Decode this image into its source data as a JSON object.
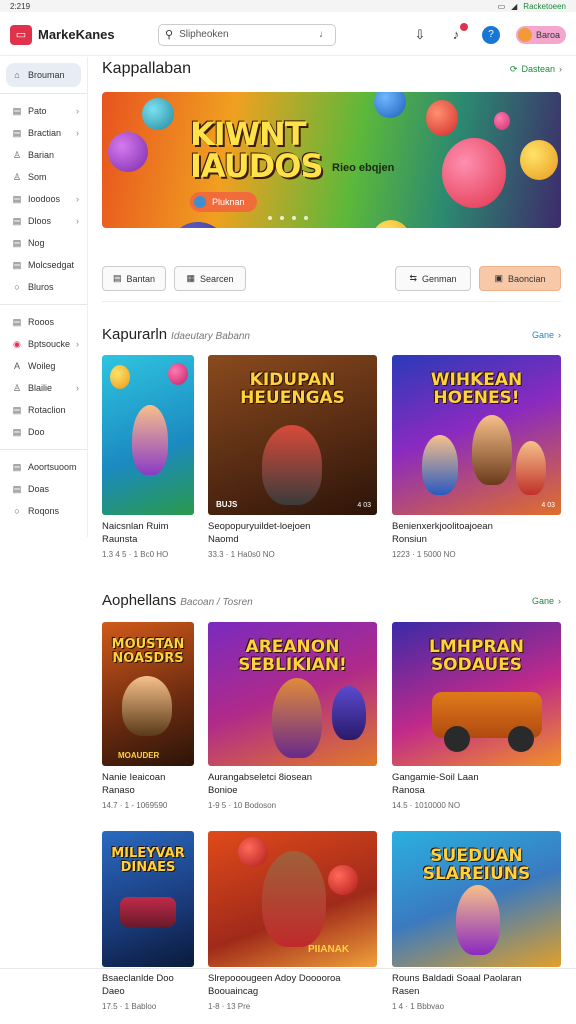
{
  "status_bar": {
    "time": "2:219",
    "right_text": "Racketoeen"
  },
  "header": {
    "app_name": "MarkeKanes",
    "search_placeholder": "Slipheoken",
    "profile_label": "Baroa"
  },
  "sidebar": {
    "items": [
      {
        "label": "Brouman",
        "icon": "home-icon",
        "active": true
      },
      {
        "label": "Pato",
        "icon": "doc-icon",
        "chevron": true
      },
      {
        "label": "Bractian",
        "icon": "doc-icon",
        "chevron": true
      },
      {
        "label": "Barian",
        "icon": "user-icon"
      },
      {
        "label": "Som",
        "icon": "user-icon"
      },
      {
        "label": "Ioodoos",
        "icon": "doc-icon",
        "chevron": true
      },
      {
        "label": "Dloos",
        "icon": "doc-icon",
        "chevron": true
      },
      {
        "label": "Nog",
        "icon": "doc-icon"
      },
      {
        "label": "Molcsedgat",
        "icon": "doc-icon"
      },
      {
        "label": "Bluros",
        "icon": "circle-icon"
      },
      {
        "label": "Rooos",
        "icon": "doc-icon"
      },
      {
        "label": "Bptsoucke",
        "icon": "red-icon",
        "chevron": true
      },
      {
        "label": "Woileg",
        "icon": "a-icon"
      },
      {
        "label": "Blailie",
        "icon": "user-icon",
        "chevron": true
      },
      {
        "label": "Rotaclion",
        "icon": "doc-icon"
      },
      {
        "label": "Doo",
        "icon": "doc-icon"
      },
      {
        "label": "Aoortsuoom",
        "icon": "doc-icon"
      },
      {
        "label": "Doas",
        "icon": "doc-icon"
      },
      {
        "label": "Roqons",
        "icon": "circle-icon"
      }
    ]
  },
  "featured": {
    "title": "Kappallaban",
    "see_all": "Dastean",
    "hero": {
      "title_line1": "KIWNT",
      "title_line2": "IAUDOS",
      "subtitle": "Rieo ebqjen",
      "button": "Pluknan"
    },
    "actions": {
      "left1": "Bantan",
      "left2": "Searcen",
      "right1": "Genman",
      "right2": "Baoncian"
    }
  },
  "section_popular": {
    "title": "Kapurarln",
    "subtitle": "Idaeutary Babann",
    "see_all": "Gane",
    "cards": [
      {
        "art_title": "",
        "line1": "Naicsnlan Ruim",
        "line2": "Raunsta",
        "meta": "1.3 4 5 · 1 Bc0 HO"
      },
      {
        "art_title": "KIDUPAN HEUENGAS",
        "art_small": "BUJS",
        "art_badge": "4 03",
        "line1": "Seopopuryuildet-loejoen",
        "line2": "Naomd",
        "meta": "33.3 · 1 Ha0s0 NO"
      },
      {
        "art_title": "WIHKEAN HOENES!",
        "art_badge": "4 03",
        "line1": "Benienxerkjoolitoajoean",
        "line2": "Ronsiun",
        "meta": "1223 · 1 5000 NO"
      }
    ]
  },
  "section_apps": {
    "title": "Aophellans",
    "subtitle": "Bacoan / Tosren",
    "see_all": "Gane",
    "cards": [
      {
        "art_title": "MOUSTAN NOASDRS",
        "art_small": "MOAUDER",
        "line1": "Nanie Ieaicoan",
        "line2": "Ranaso",
        "meta": "14.7 · 1 - 1069590"
      },
      {
        "art_title": "AREANON SEBLIKIAN!",
        "line1": "Aurangabseletci 8iosean",
        "line2": "Bonioe",
        "meta": "1-9 5 · 10 Bodoson"
      },
      {
        "art_title": "LMHPRAN SODAUES",
        "line1": "Gangamie-Soil Laan",
        "line2": "Ranosa",
        "meta": "14.5 · 1010000 NO"
      },
      {
        "art_title": "MILEYVAR DINAES",
        "line1": "Bsaeclanlde Doo",
        "line2": "Daeo",
        "meta": "17.5 · 1 Babloo"
      },
      {
        "art_title": "PIIANAK",
        "line1": "Slrepooougeen Adoy Dooooroa",
        "line2": "Boouaincag",
        "meta": "1-8 · 13 Pre"
      },
      {
        "art_title": "SUEDUAN SLAREIUNS",
        "line1": "Rouns Baldadi Soaal Paolaran",
        "line2": "Rasen",
        "meta": "1 4 · 1 Bbbvao"
      }
    ]
  },
  "colors": {
    "accent": "#e0334b",
    "green_link": "#1b8a3a",
    "blue_link": "#1e88c8",
    "primary_button": "#f8c9a8",
    "hero_button": "#f26b3a"
  }
}
